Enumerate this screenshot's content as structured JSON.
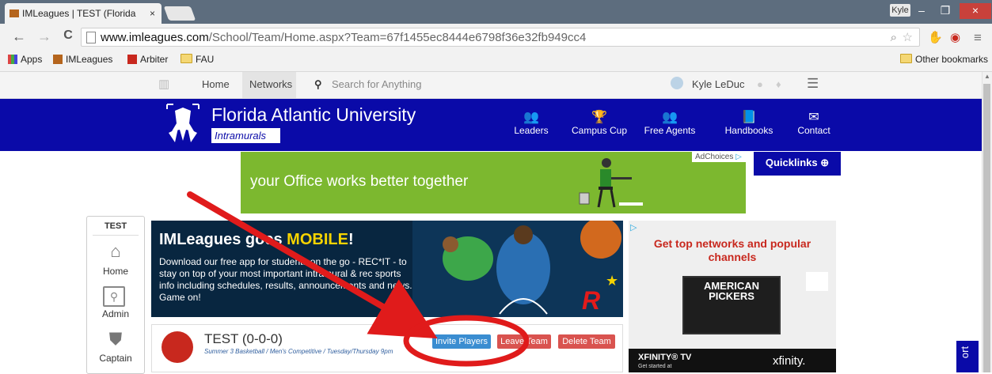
{
  "browser": {
    "tab_title": "IMLeagues | TEST (Florida",
    "tab_close": "×",
    "user_badge": "Kyle",
    "win_min": "–",
    "win_max": "❐",
    "win_close": "×",
    "url_domain": "www.imleagues.com",
    "url_path": "/School/Team/Home.aspx?Team=67f1455ec8444e6798f36e32fb949cc4",
    "back_icon": "←",
    "forward_icon": "→",
    "reload_icon": "C",
    "menu_icon": "≡"
  },
  "bookmarks": {
    "apps": "Apps",
    "imleagues": "IMLeagues",
    "arbiter": "Arbiter",
    "fau": "FAU",
    "other": "Other bookmarks"
  },
  "sitenav": {
    "home": "Home",
    "networks": "Networks",
    "search_placeholder": "Search for Anything",
    "user_name": "Kyle LeDuc"
  },
  "header": {
    "university": "Florida Atlantic University",
    "subtitle": "Intramurals",
    "nav": [
      "Leaders",
      "Campus Cup",
      "Free Agents",
      "Handbooks",
      "Contact"
    ]
  },
  "ad_banner": {
    "text": "your Office works better together",
    "adchoices": "AdChoices",
    "quicklinks": "Quicklinks"
  },
  "sidebar": {
    "team_code": "TEST",
    "items": [
      "Home",
      "Admin",
      "Captain"
    ]
  },
  "promo": {
    "title_start": "IMLeagues goes ",
    "title_highlight": "MOBILE",
    "title_end": "!",
    "body": "Download our free app for students on the go - REC*IT - to stay on top of your most important intramural & rec sports info including schedules, results, announcements and news. Game on!"
  },
  "team": {
    "name": "TEST (0-0-0)",
    "meta": "Summer 3 Basketball / Men's Competitive / Tuesday/Thursday 9pm",
    "invite": "Invite Players",
    "leave": "Leave Team",
    "delete": "Delete Team"
  },
  "right_ad": {
    "title": "Get top networks and popular channels",
    "show": "AMERICAN PICKERS",
    "brand_line": "XFINITY® TV",
    "brand_sub": "Get started at",
    "logo": "xfinity."
  },
  "feedback_tab": "ort",
  "colors": {
    "brand_blue": "#0a0aa8",
    "invite_blue": "#3a8dd1",
    "danger_red": "#d9534f",
    "ad_green": "#7cb82f"
  }
}
